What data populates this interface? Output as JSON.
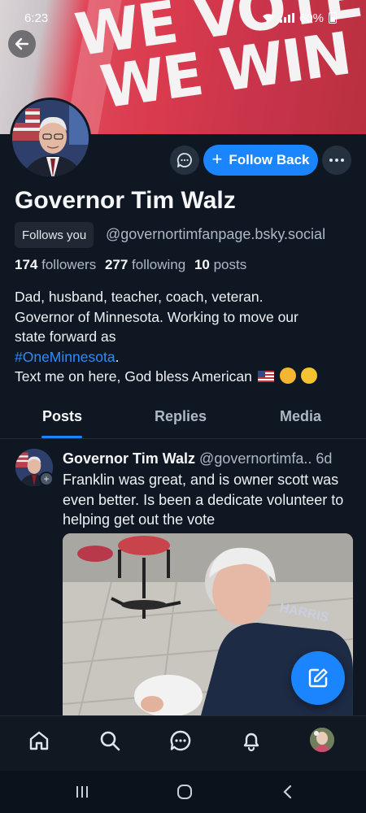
{
  "status_bar": {
    "time": "6:23",
    "battery": "60%"
  },
  "banner": {
    "line1": "WE VOTE",
    "line2": "WE WIN"
  },
  "profile": {
    "display_name": "Governor Tim Walz",
    "follows_you_label": "Follows you",
    "handle": "@governortimfanpage.bsky.social",
    "followers_count": "174",
    "followers_label": "followers",
    "following_count": "277",
    "following_label": "following",
    "posts_count": "10",
    "posts_label": "posts",
    "bio_line1": "Dad, husband, teacher, coach, veteran.",
    "bio_line2": "Governor of Minnesota. Working to move our",
    "bio_line3": "state forward as",
    "bio_hashtag": "#OneMinnesota",
    "bio_hashtag_suffix": ".",
    "bio_line5": "Text me on here,  God bless American"
  },
  "actions": {
    "follow_back_label": "Follow Back",
    "plus_glyph": "+"
  },
  "tabs": [
    {
      "label": "Posts",
      "active": true
    },
    {
      "label": "Replies",
      "active": false
    },
    {
      "label": "Media",
      "active": false
    }
  ],
  "post": {
    "author": "Governor Tim Walz",
    "handle_time": "@governortimfa.. 6d",
    "text": "Franklin was great, and is owner scott was even better. Is been a dedicate volunteer to helping get out the vote",
    "avatar_plus": "+"
  },
  "bottom_nav": [
    {
      "name": "home",
      "icon": "home-icon"
    },
    {
      "name": "search",
      "icon": "search-icon"
    },
    {
      "name": "chat",
      "icon": "chat-icon"
    },
    {
      "name": "notifications",
      "icon": "bell-icon"
    },
    {
      "name": "profile",
      "icon": "avatar"
    }
  ],
  "colors": {
    "accent": "#1a85ff",
    "background": "#0f1722",
    "muted_text": "#aeb8c4"
  }
}
